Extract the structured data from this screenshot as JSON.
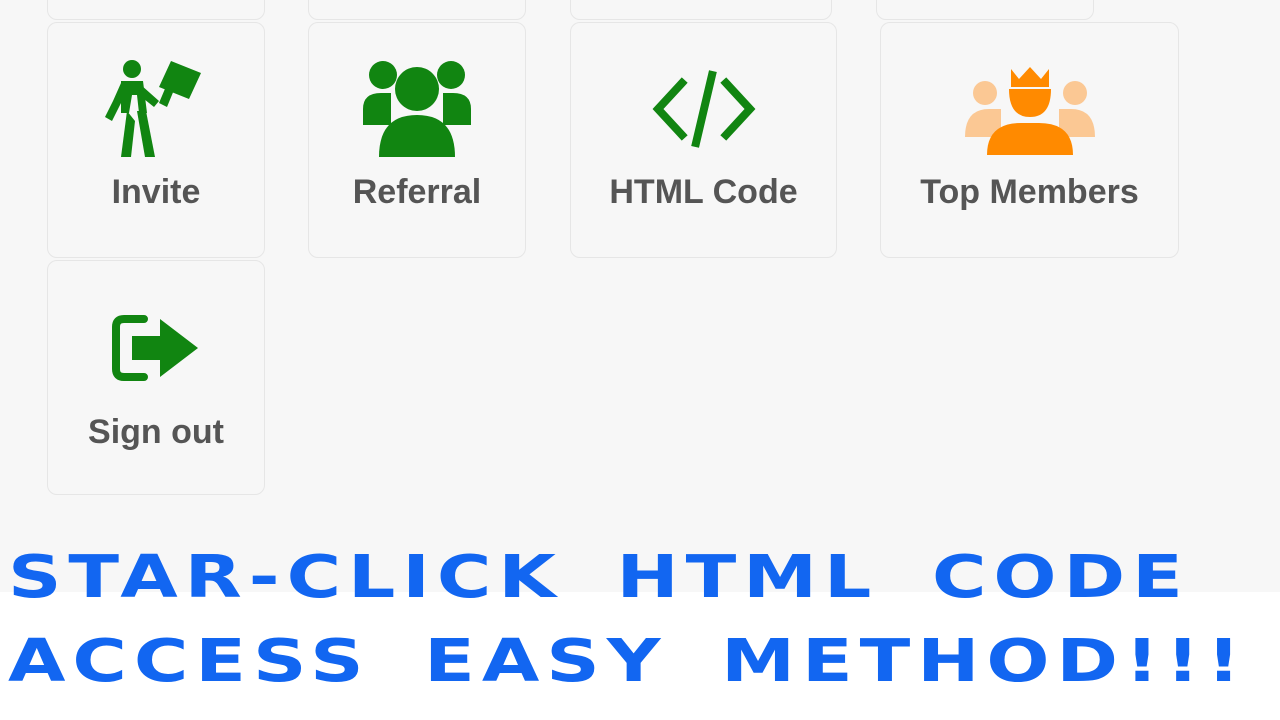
{
  "menu": {
    "items": [
      {
        "id": "invite",
        "label": "Invite",
        "icon": "invite-icon",
        "icon_color": "#118511"
      },
      {
        "id": "referral",
        "label": "Referral",
        "icon": "referral-group-icon",
        "icon_color": "#118511"
      },
      {
        "id": "html-code",
        "label": "HTML Code",
        "icon": "code-brackets-icon",
        "icon_color": "#118511"
      },
      {
        "id": "top-members",
        "label": "Top Members",
        "icon": "crown-members-icon",
        "icon_color": "#ff8a00"
      },
      {
        "id": "sign-out",
        "label": "Sign out",
        "icon": "sign-out-icon",
        "icon_color": "#118511"
      }
    ]
  },
  "overlay": {
    "line1": "STAR-CLICK HTML CODE",
    "line2": "ACCESS EASY METHOD!!!",
    "color": "#1266f1"
  }
}
